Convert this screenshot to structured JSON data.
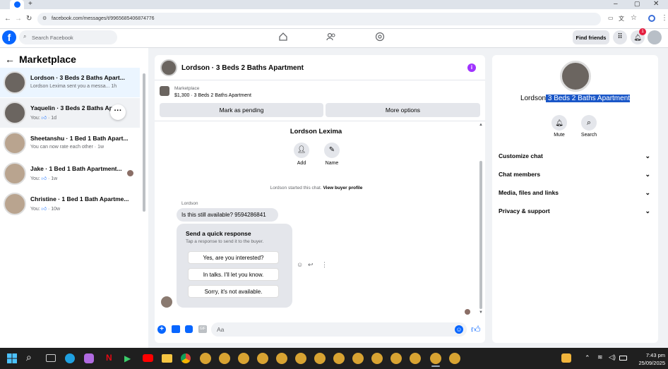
{
  "browser": {
    "url": "facebook.com/messages/t/9965685406874776"
  },
  "fb": {
    "search_placeholder": "Search Facebook",
    "find_friends": "Find friends",
    "notification_count": "1"
  },
  "marketplace": {
    "title": "Marketplace",
    "conversations": [
      {
        "title": "Lordson · 3 Beds 2 Baths Apart...",
        "snippet": "Lordson Lexima sent you a messa... 1h"
      },
      {
        "title": "Yaquelin · 3 Beds 2 Baths Ap",
        "snippet_prefix": "You:",
        "snippet_suffix": "· 1d"
      },
      {
        "title": "Sheetanshu · 1 Bed 1 Bath Apart...",
        "snippet": "You can now rate each other · 1w"
      },
      {
        "title": "Jake · 1 Bed 1 Bath Apartment...",
        "snippet_prefix": "You:",
        "snippet_suffix": "· 1w"
      },
      {
        "title": "Christine · 1 Bed 1 Bath Apartme...",
        "snippet_prefix": "You:",
        "snippet_suffix": "· 10w"
      }
    ]
  },
  "chat": {
    "header_title": "Lordson · 3 Beds 2 Baths Apartment",
    "listing_source": "Marketplace",
    "listing_detail": "$1,300 · 3 Beds 2 Baths Apartment",
    "mark_pending": "Mark as pending",
    "more_options": "More options",
    "contact_name": "Lordson Lexima",
    "add_label": "Add",
    "name_label": "Name",
    "started_text": "Lordson started this chat.",
    "view_profile": "View buyer profile",
    "sender_name": "Lordson",
    "message": "Is this still available? 9594286841",
    "quick_title": "Send a quick response",
    "quick_sub": "Tap a response to send it to the buyer.",
    "quick_responses": [
      "Yes, are you interested?",
      "In talks. I'll let you know.",
      "Sorry, it's not available."
    ],
    "composer_placeholder": "Aa"
  },
  "profile": {
    "name": "Lordson",
    "name_highlighted": " 3 Beds 2 Baths Apartment",
    "mute": "Mute",
    "search": "Search",
    "sections": [
      "Customize chat",
      "Chat members",
      "Media, files and links",
      "Privacy & support"
    ]
  },
  "taskbar": {
    "time": "7:43 pm",
    "date": "25/09/2025"
  },
  "colors": {
    "fb_blue": "#0866ff",
    "highlight": "#1a57c8",
    "badge_red": "#e41e3f"
  }
}
